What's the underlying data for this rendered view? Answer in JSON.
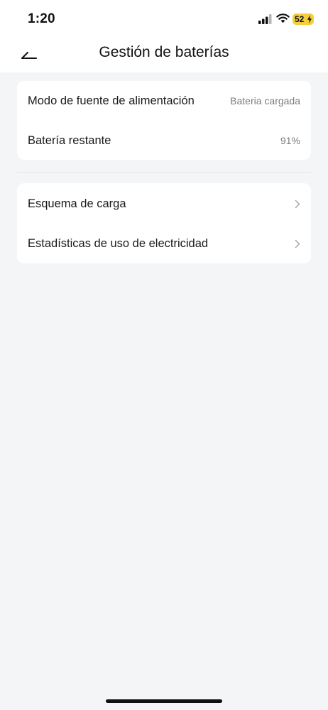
{
  "status_bar": {
    "time": "1:20",
    "battery": "52",
    "battery_color": "#f4cf3b"
  },
  "header": {
    "title": "Gestión de baterías",
    "back_icon": "back-arrow-icon"
  },
  "sections": [
    {
      "rows": [
        {
          "label": "Modo de fuente de alimentación",
          "value": "Bateria cargada"
        },
        {
          "label": "Batería restante",
          "value": "91%"
        }
      ]
    },
    {
      "rows": [
        {
          "label": "Esquema de carga",
          "icon": "chevron-right-icon"
        },
        {
          "label": "Estadísticas de uso de electricidad",
          "icon": "chevron-right-icon"
        }
      ]
    }
  ]
}
